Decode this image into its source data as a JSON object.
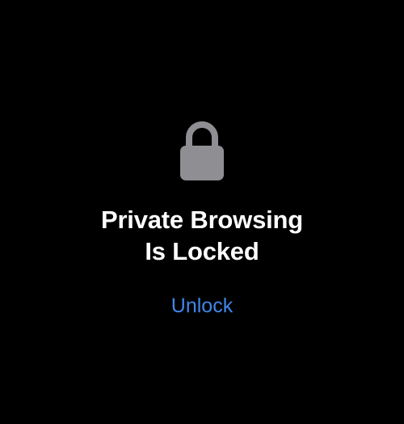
{
  "lock_screen": {
    "icon": "lock-icon",
    "title_line_1": "Private Browsing",
    "title_line_2": "Is Locked",
    "unlock_label": "Unlock",
    "colors": {
      "background": "#000000",
      "icon": "#8e8e93",
      "title": "#ffffff",
      "link": "#3f86ea"
    }
  }
}
